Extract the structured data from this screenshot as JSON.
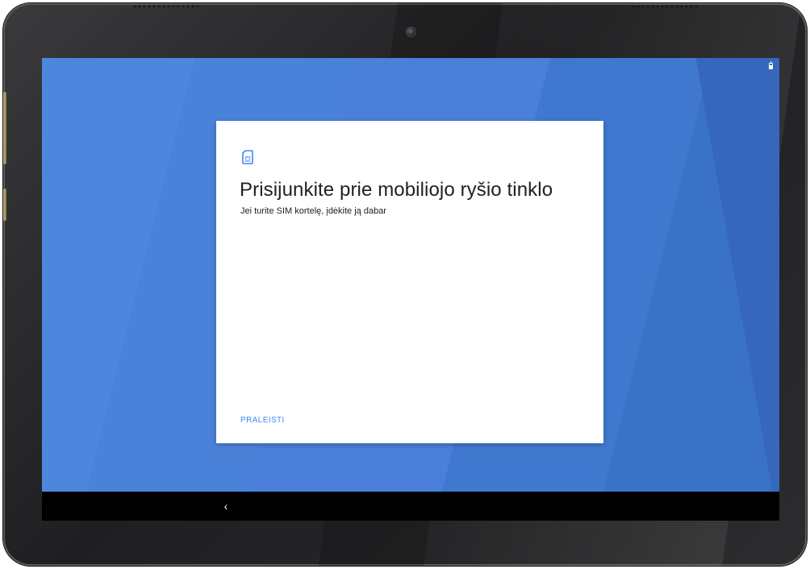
{
  "screen": {
    "wallpaper_color": "#4a80da",
    "status_bar": {
      "icon": "battery-icon"
    }
  },
  "dialog": {
    "icon": "sim-card-icon",
    "title": "Prisijunkite prie mobiliojo ryšio tinklo",
    "subtitle": "Jei turite SIM kortelę, įdėkite ją dabar",
    "skip_label": "PRALEISTI",
    "accent_color": "#4285f4"
  },
  "navbar": {
    "back_icon": "back-icon",
    "back_glyph": "‹"
  }
}
